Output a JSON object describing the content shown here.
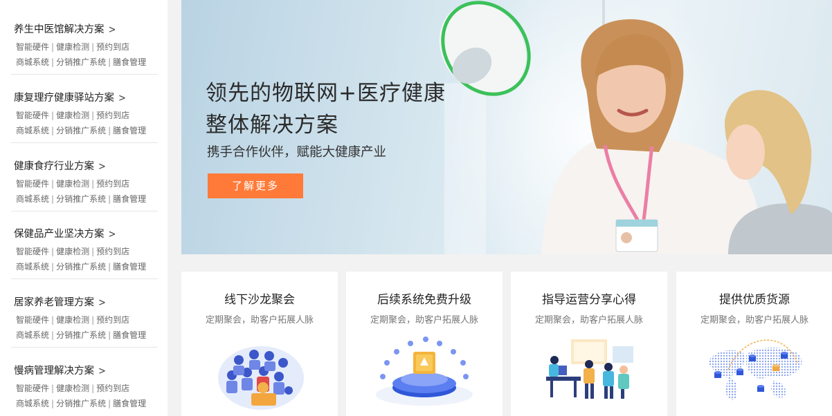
{
  "sidebar": {
    "groups": [
      {
        "title": "养生中医馆解决方案",
        "chevron": "chevron-right-icon",
        "line1": [
          "智能硬件",
          "健康检测",
          "预约到店"
        ],
        "line2": [
          "商城系统",
          "分销推广系统",
          "膳食管理"
        ]
      },
      {
        "title": "康复理疗健康驿站方案",
        "chevron": "chevron-right-icon",
        "line1": [
          "智能硬件",
          "健康检测",
          "预约到店"
        ],
        "line2": [
          "商城系统",
          "分销推广系统",
          "膳食管理"
        ]
      },
      {
        "title": "健康食疗行业方案",
        "chevron": "chevron-right-icon",
        "line1": [
          "智能硬件",
          "健康检测",
          "预约到店"
        ],
        "line2": [
          "商城系统",
          "分销推广系统",
          "膳食管理"
        ]
      },
      {
        "title": "保健品产业坚决方案",
        "chevron": "chevron-right-icon",
        "line1": [
          "智能硬件",
          "健康检测",
          "预约到店"
        ],
        "line2": [
          "商城系统",
          "分销推广系统",
          "膳食管理"
        ]
      },
      {
        "title": "居家养老管理方案",
        "chevron": "chevron-right-icon",
        "line1": [
          "智能硬件",
          "健康检测",
          "预约到店"
        ],
        "line2": [
          "商城系统",
          "分销推广系统",
          "膳食管理"
        ]
      },
      {
        "title": "慢病管理解决方案",
        "chevron": "chevron-right-icon",
        "line1": [
          "智能硬件",
          "健康检测",
          "预约到店"
        ],
        "line2": [
          "商城系统",
          "分销推广系统",
          "膳食管理"
        ]
      }
    ],
    "separator": "|"
  },
  "banner": {
    "title_line1": "领先的物联网+医疗健康",
    "title_line2": "整体解决方案",
    "subtitle": "携手合作伙伴，赋能大健康产业",
    "cta_label": "了解更多",
    "cta_color": "#ff7a38"
  },
  "features": [
    {
      "title": "线下沙龙聚会",
      "desc": "定期聚会，助客户拓展人脉",
      "icon": "crowd-illustration"
    },
    {
      "title": "后续系统免费升级",
      "desc": "定期聚会，助客户拓展人脉",
      "icon": "platform-upgrade-illustration"
    },
    {
      "title": "指导运营分享心得",
      "desc": "定期聚会，助客户拓展人脉",
      "icon": "team-meeting-illustration"
    },
    {
      "title": "提供优质货源",
      "desc": "定期聚会，助客户拓展人脉",
      "icon": "world-map-illustration"
    }
  ]
}
